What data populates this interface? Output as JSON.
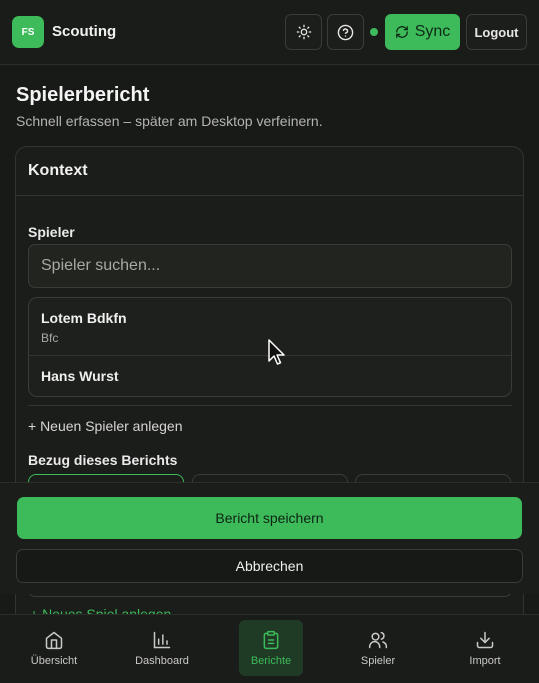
{
  "header": {
    "logo_text": "FS",
    "app_title": "Scouting",
    "sync_label": "Sync",
    "logout_label": "Logout",
    "online_color": "#3dbb5a"
  },
  "page": {
    "title": "Spielerbericht",
    "subtitle": "Schnell erfassen – später am Desktop verfeinern."
  },
  "context_card": {
    "title": "Kontext",
    "player_label": "Spieler",
    "search_placeholder": "Spieler suchen...",
    "results": [
      {
        "name": "Lotem Bdkfn",
        "club": "Bfc"
      },
      {
        "name": "Hans Wurst",
        "club": ""
      }
    ],
    "new_player_label": "+ Neuen Spieler anlegen",
    "reference_label": "Bezug dieses Berichts",
    "new_game_label": "+ Neues Spiel anlegen"
  },
  "actions": {
    "save_label": "Bericht speichern",
    "cancel_label": "Abbrechen"
  },
  "bottom_nav": {
    "items": [
      {
        "label": "Übersicht",
        "icon": "home-icon",
        "active": false
      },
      {
        "label": "Dashboard",
        "icon": "bar-chart-icon",
        "active": false
      },
      {
        "label": "Berichte",
        "icon": "clipboard-icon",
        "active": true
      },
      {
        "label": "Spieler",
        "icon": "users-icon",
        "active": false
      },
      {
        "label": "Import",
        "icon": "download-icon",
        "active": false
      }
    ]
  },
  "colors": {
    "accent": "#3dbb5a",
    "background": "#181a17"
  }
}
